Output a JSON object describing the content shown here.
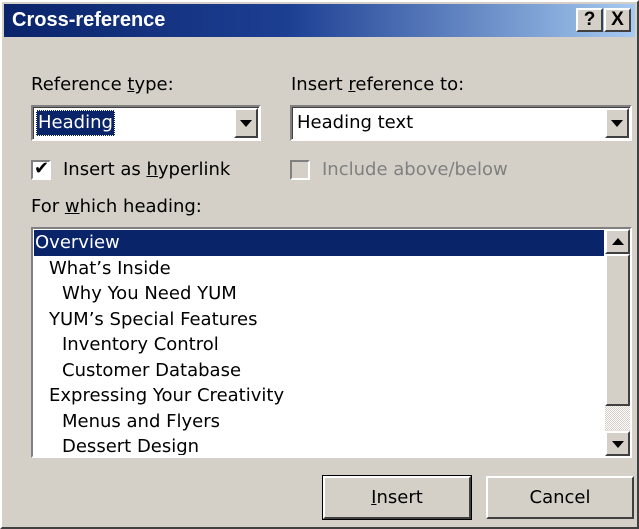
{
  "window": {
    "title": "Cross-reference",
    "help_button": "?",
    "close_button": "X"
  },
  "reference_type": {
    "label_pre": "Reference ",
    "label_accel": "t",
    "label_post": "ype:",
    "value": "Heading"
  },
  "insert_reference_to": {
    "label_pre": "Insert ",
    "label_accel": "r",
    "label_post": "eference to:",
    "value": "Heading text"
  },
  "insert_as_hyperlink": {
    "label_pre": "Insert as ",
    "label_accel": "h",
    "label_post": "yperlink",
    "checked": true,
    "check_glyph": "✔"
  },
  "include_above_below": {
    "label": "Include above/below",
    "enabled": false,
    "checked": false
  },
  "for_which_heading": {
    "label_pre": "For ",
    "label_accel": "w",
    "label_post": "hich heading:",
    "selected_index": 0,
    "items": [
      {
        "text": "Overview",
        "level": 1
      },
      {
        "text": "What’s Inside",
        "level": 2
      },
      {
        "text": "Why You Need YUM",
        "level": 3
      },
      {
        "text": "YUM’s Special Features",
        "level": 2
      },
      {
        "text": "Inventory Control",
        "level": 3
      },
      {
        "text": "Customer Database",
        "level": 3
      },
      {
        "text": "Expressing Your Creativity",
        "level": 2
      },
      {
        "text": "Menus and Flyers",
        "level": 3
      },
      {
        "text": "Dessert Design",
        "level": 3
      }
    ]
  },
  "buttons": {
    "insert_accel": "I",
    "insert_rest": "nsert",
    "cancel": "Cancel"
  },
  "colors": {
    "dialog_bg": "#d4d0c8",
    "title_start": "#0a246a",
    "title_end": "#a6caf0",
    "selection": "#0a246a",
    "disabled_text": "#808080"
  }
}
